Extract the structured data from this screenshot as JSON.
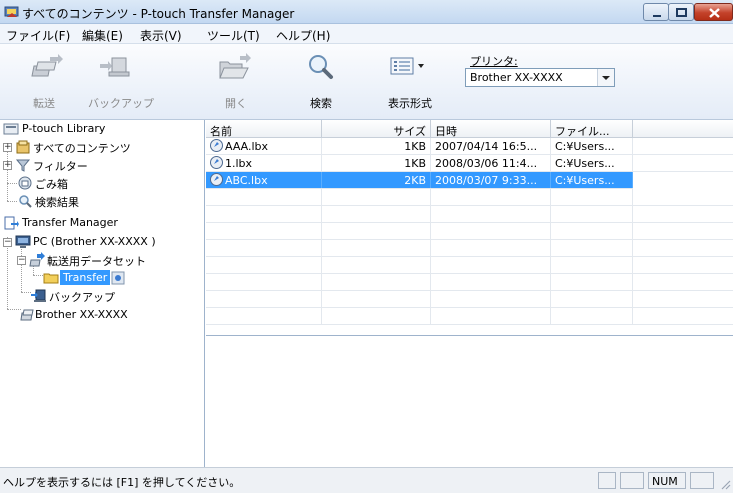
{
  "window": {
    "title": "すべてのコンテンツ - P-touch Transfer Manager"
  },
  "menu": [
    "ファイル(F)",
    "編集(E)",
    "表示(V)",
    "ツール(T)",
    "ヘルプ(H)"
  ],
  "toolbar": {
    "transfer_label": "転送",
    "backup_label": "バックアップ",
    "open_label": "開く",
    "search_label": "検索",
    "view_label": "表示形式",
    "printer_label": "プリンタ:",
    "printer_value": "Brother XX-XXXX"
  },
  "tree": {
    "library": "P-touch Library",
    "all_contents": "すべてのコンテンツ",
    "filter": "フィルター",
    "trash": "ごみ箱",
    "search_results": "検索結果",
    "transfer_manager": "Transfer Manager",
    "pc": "PC (Brother XX-XXXX )",
    "transfer_set": "転送用データセット",
    "transfer_folder": "Transfer",
    "backup": "バックアップ",
    "printer": "Brother XX-XXXX"
  },
  "grid": {
    "columns": [
      "名前",
      "サイズ",
      "日時",
      "ファイル..."
    ],
    "rows": [
      {
        "name": "AAA.lbx",
        "size": "1KB",
        "date": "2007/04/14 16:5...",
        "path": "C:¥Users..."
      },
      {
        "name": "1.lbx",
        "size": "1KB",
        "date": "2008/03/06 11:4...",
        "path": "C:¥Users..."
      },
      {
        "name": "ABC.lbx",
        "size": "2KB",
        "date": "2008/03/07 9:33...",
        "path": "C:¥Users..."
      }
    ]
  },
  "status": {
    "text": "ヘルプを表示するには [F1] を押してください。",
    "num": "NUM"
  },
  "colors": {
    "selection": "#3399ff",
    "titlebar": "#c3d8f1",
    "close_button": "#c4422a"
  }
}
